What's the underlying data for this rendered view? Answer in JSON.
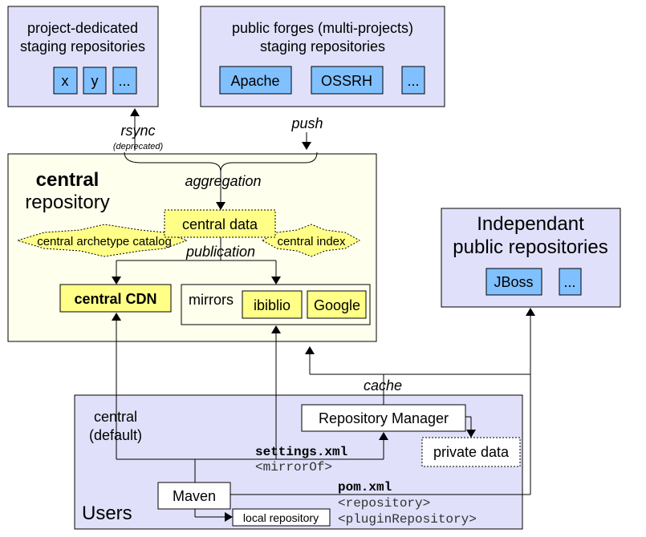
{
  "staging_project": {
    "title_lines": [
      "project-dedicated",
      "staging repositories"
    ],
    "items": [
      "x",
      "y",
      "..."
    ]
  },
  "staging_forges": {
    "title_lines": [
      "public forges (multi-projects)",
      "staging repositories"
    ],
    "items": [
      "Apache",
      "OSSRH",
      "..."
    ]
  },
  "rsync": {
    "label": "rsync",
    "note": "(deprecated)"
  },
  "push": {
    "label": "push"
  },
  "central": {
    "title_bold": "central",
    "title": "repository",
    "aggregation": "aggregation",
    "central_data": "central data",
    "archetype_catalog": "central archetype catalog",
    "index": "central index",
    "publication": "publication",
    "cdn": "central CDN",
    "mirrors": {
      "label": "mirrors",
      "items": [
        "ibiblio",
        "Google"
      ]
    }
  },
  "independent": {
    "title_lines": [
      "Independant",
      "public repositories"
    ],
    "items": [
      "JBoss",
      "..."
    ]
  },
  "cache": "cache",
  "users": {
    "label": "Users",
    "central_default": [
      "central",
      "(default)"
    ],
    "repository_manager": "Repository Manager",
    "private_data": "private data",
    "settings": {
      "file": "settings.xml",
      "tag": "<mirrorOf>"
    },
    "maven": "Maven",
    "local_repository": "local repository",
    "pom": {
      "file": "pom.xml",
      "tags": [
        "<repository>",
        "<pluginRepository>"
      ]
    }
  },
  "colors": {
    "lavender": "#e0e0fa",
    "blue": "#80c0ff",
    "cream": "#ffffee",
    "yellow": "#ffff88"
  }
}
